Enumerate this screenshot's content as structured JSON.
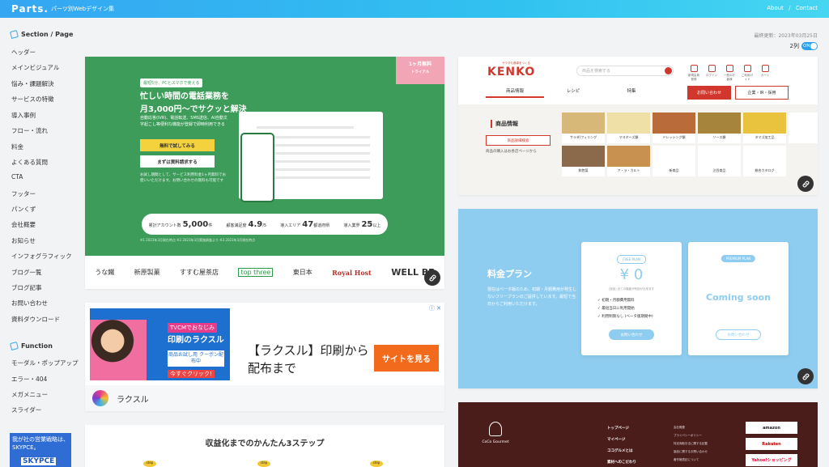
{
  "header": {
    "logo": "Parts.",
    "tagline": "パーツ別Webデザイン集",
    "nav": [
      "About",
      "/",
      "Contact"
    ]
  },
  "sidebar": {
    "section1": "Section / Page",
    "items": [
      "ヘッダー",
      "メインビジュアル",
      "悩み・課題解決",
      "サービスの特徴",
      "導入事例",
      "フロー・流れ",
      "料金",
      "よくある質問",
      "CTA",
      "フッター",
      "パンくず",
      "会社概要",
      "お知らせ",
      "インフォグラフィック",
      "ブログ一覧",
      "ブログ記事",
      "お問い合わせ",
      "資料ダウンロード"
    ],
    "section2": "Function",
    "items2": [
      "モーダル・ポップアップ",
      "エラー・404",
      "メガメニュー",
      "スライダー"
    ],
    "ad_text": "我が社の営業戦略は、SKYPCE。",
    "ad_big": "SKYPCE"
  },
  "meta": {
    "updated": "最終更新：2023年03月25日",
    "cols_label": "2列",
    "toggle": "ON"
  },
  "card1": {
    "badge": "最短5分、PCとスマホで使える",
    "head1": "忙しい時間の電話業務を",
    "head2": "月3,000円〜でサクッと解決",
    "desc": "自動応答(IVR)、電話転送、SMS送信、AI自動文字起こし等便利な機能が登録で即時利用できる",
    "btn_trial": "無料で試してみる",
    "btn_doc": "まずは資料請求する",
    "note": "お試し期間として、サービス利用料金1ヶ月無料でお使いいただけます。お問い合わせの無料も可能です",
    "ribbon1": "1ヶ月無料",
    "ribbon2": "トライアル",
    "stats": [
      {
        "label": "累計アカウント数",
        "value": "5,000",
        "unit": "件"
      },
      {
        "label": "顧客満足度",
        "value": "4.9",
        "unit": "/5"
      },
      {
        "label": "導入エリア",
        "value": "47",
        "unit": "都道府県"
      },
      {
        "label": "導入業界",
        "value": "25",
        "unit": "以上"
      }
    ],
    "footnote": "※1 2023年3月現在時点   ※2 2023年3月実施調査より   ※3 2023年3月現在時点",
    "logos": [
      "うな鐵",
      "新原製菓",
      "すすむ屋茶店",
      "top three",
      "東日本",
      "Royal Host",
      "WELL BE"
    ]
  },
  "card2": {
    "adchoice": "ⓘ ✕",
    "tvcm": "TVCMでおなじみ",
    "rak": "印刷のラクスル",
    "coupon": "商品お試し用 クーポン配布中",
    "click": "今すぐクリック!",
    "title": "【ラクスル】印刷から配布まで",
    "cta": "サイトを見る",
    "advertiser": "ラクスル"
  },
  "card3": {
    "title": "収益化までのかんたん3ステップ",
    "step": "step"
  },
  "card4": {
    "logo": "KENKO",
    "sub": "サラダも食卓をつくる",
    "search": "商品を検索する",
    "icons": [
      "新規会員登録",
      "ログイン",
      "一般のお客様",
      "ご利用ガイド",
      "カート"
    ],
    "contact": "お問い合わせ",
    "recruit": "企業・IR・採用",
    "tabs": [
      "商品情報",
      "レシピ",
      "特集"
    ],
    "panel_head": "商品情報",
    "panel_btn": "商品詳細検索",
    "panel_note": "商品の購入はお各店ページから",
    "grid": [
      {
        "label": "サラダ/フィリング",
        "color": "#d8b878"
      },
      {
        "label": "マヨネーズ類",
        "color": "#efe0a8"
      },
      {
        "label": "ドレッシング類",
        "color": "#b96b3a"
      },
      {
        "label": "ソース類",
        "color": "#a7843b"
      },
      {
        "label": "タマゴ加工品",
        "color": "#e9c23e"
      },
      {
        "label": "",
        "color": "#ffffff"
      },
      {
        "label": "和惣菜",
        "color": "#8a6a4a"
      },
      {
        "label": "ア・ラ・カルト",
        "color": "#c99150"
      },
      {
        "label": "新商品",
        "color": "#ffffff"
      },
      {
        "label": "注目商品",
        "color": "#ffffff"
      },
      {
        "label": "総合カタログ",
        "color": "#ffffff"
      }
    ]
  },
  "card5": {
    "title": "料金プラン",
    "desc": "現在はベータ版のため、初期・月額費用が発生しないフリープランのご提供しています。最短で当日からご利用いただけます。",
    "free_tag": "FREE PLAN",
    "price": "¥ 0",
    "price_sub": "(追加) 全ての機能が利用が出来ます",
    "features": [
      "✓ 初期・月額費用無料",
      "✓ 最短当日に利用開始",
      "✓ 利用制限なし (ベータ版期間中)"
    ],
    "free_btn": "お問い合わせ",
    "premium_tag": "PREMIUM PLAN",
    "soon": "Coming soon",
    "premium_btn": "お問い合わせ"
  },
  "card6": {
    "brand": "CoCo Gourmet",
    "nav": [
      "トップページ",
      "マイページ",
      "ココグルメとは",
      "素材へのこだわり"
    ],
    "sub": [
      "会社概要",
      "プライバシーポリシー",
      "特定商取引法に関する記載",
      "製品に関するお問い合わせ",
      "著作権表記について"
    ],
    "shops": [
      "amazon",
      "Rakuten",
      "Yahoo!ショッピング"
    ]
  }
}
